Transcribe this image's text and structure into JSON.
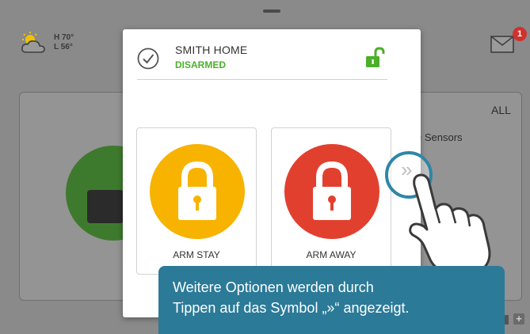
{
  "weather": {
    "high": "H 70°",
    "low": "L 56°"
  },
  "mail": {
    "badge_count": "1"
  },
  "background": {
    "filter_label": "ALL",
    "sensors_label": "e Sensors"
  },
  "modal": {
    "home_name": "SMITH HOME",
    "status": "DISARMED",
    "options": [
      {
        "label": "ARM STAY",
        "color": "#f7b300"
      },
      {
        "label": "ARM AWAY",
        "color": "#e2402f"
      }
    ],
    "more_glyph": "»"
  },
  "tooltip": {
    "line1": "Weitere Optionen werden durch",
    "line2": "Tippen auf das Symbol „»“ angezeigt."
  },
  "colors": {
    "accent_green": "#4caf2a",
    "tooltip_blue": "#2b7a98",
    "ring_blue": "#2f86a6"
  }
}
